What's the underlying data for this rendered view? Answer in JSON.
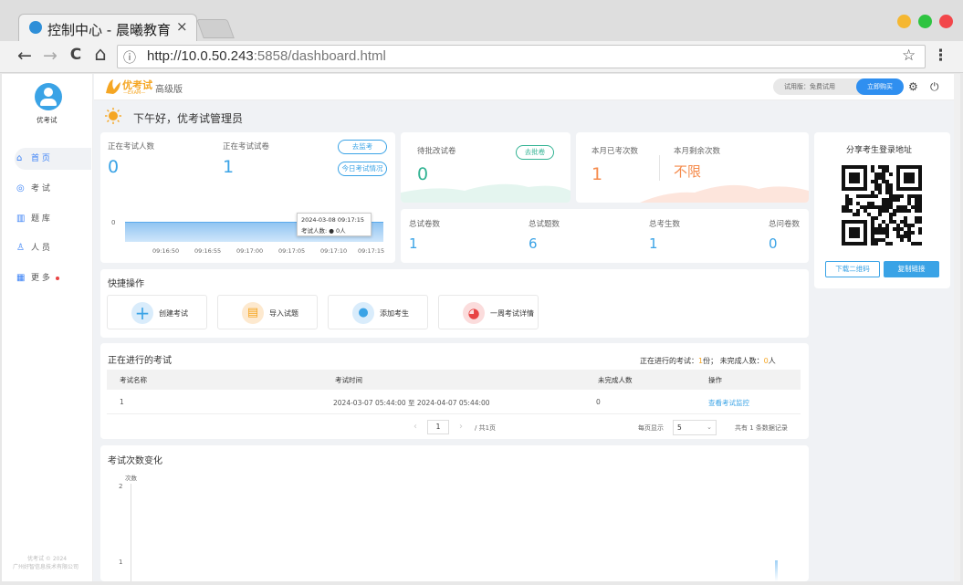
{
  "browser": {
    "tab_title": "控制中心 - 晨曦教育",
    "tab_close": "×",
    "url_host": "http://10.0.50.243",
    "url_path": ":5858/dashboard.html",
    "back": "←",
    "forward": "→",
    "reload": "C",
    "home": "⌂",
    "star": "☆",
    "menu": "⋮",
    "info": "ⓘ"
  },
  "sidebar": {
    "username": "优考试",
    "items": [
      {
        "label": "首 页",
        "icon": "home-icon",
        "glyph": "⌂"
      },
      {
        "label": "考 试",
        "icon": "exam-icon",
        "glyph": "◎"
      },
      {
        "label": "题 库",
        "icon": "question-bank-icon",
        "glyph": "▥"
      },
      {
        "label": "人 员",
        "icon": "person-icon",
        "glyph": "♙"
      },
      {
        "label": "更 多",
        "icon": "more-icon",
        "glyph": "▦"
      }
    ],
    "footer_line1": "优考试 © 2024",
    "footer_line2": "广州好智信息技术有限公司"
  },
  "header": {
    "logo_text": "优考试",
    "logo_sub": "—EXAM—",
    "edition": "高级版",
    "trial_label": "试用版：免费试用",
    "buy_label": "立即购买"
  },
  "greeting": "下午好，优考试管理员",
  "stats_online": {
    "examinee_label": "正在考试人数",
    "examinee_value": "0",
    "paper_label": "正在考试试卷",
    "paper_value": "1",
    "monitor_btn": "去监考",
    "today_btn": "今日考试情况",
    "chart_y_label": "0",
    "chart_x_ticks": [
      "09:16:50",
      "09:16:55",
      "09:17:00",
      "09:17:05",
      "09:17:10",
      "09:17:15"
    ],
    "tooltip_time": "2024-03-08 09:17:15",
    "tooltip_text": "考试人数: ● 0人"
  },
  "pending": {
    "label": "待批改试卷",
    "value": "0",
    "btn": "去批卷"
  },
  "month": {
    "done_label": "本月已考次数",
    "done_value": "1",
    "left_label": "本月剩余次数",
    "left_value": "不限"
  },
  "totals": [
    {
      "label": "总试卷数",
      "value": "1"
    },
    {
      "label": "总试题数",
      "value": "6"
    },
    {
      "label": "总考生数",
      "value": "1"
    },
    {
      "label": "总问卷数",
      "value": "0"
    }
  ],
  "share": {
    "title": "分享考生登录地址",
    "download_btn": "下载二维码",
    "copy_btn": "复制链接"
  },
  "quick": {
    "title": "快捷操作",
    "items": [
      {
        "label": "创建考试",
        "icon": "plus-icon",
        "glyph": "+",
        "color": "#3aa3e6"
      },
      {
        "label": "导入试题",
        "icon": "document-icon",
        "glyph": "▤",
        "color": "#f5a623"
      },
      {
        "label": "添加考生",
        "icon": "user-icon",
        "glyph": "●",
        "color": "#3aa3e6"
      },
      {
        "label": "一周考试详情",
        "icon": "pie-chart-icon",
        "glyph": "◕",
        "color": "#e84343"
      }
    ]
  },
  "ongoing": {
    "title": "正在进行的考试",
    "summary_prefix": "正在进行的考试：",
    "summary_count": "1",
    "summary_mid": "份；  未完成人数：",
    "summary_unfinished": "0",
    "summary_suffix": "人",
    "columns": [
      "考试名称",
      "考试时间",
      "未完成人数",
      "操作"
    ],
    "rows": [
      {
        "name": "1",
        "time": "2024-03-07 05:44:00 至 2024-04-07 05:44:00",
        "unfinished": "0",
        "action": "查看考试监控"
      }
    ],
    "pagination": {
      "prev": "‹",
      "page": "1",
      "next": "›",
      "total_pages": "/ 共1页",
      "per_page_label": "每页显示",
      "per_page": "5",
      "records": "共有 1 条数据记录"
    }
  },
  "trend": {
    "title": "考试次数变化",
    "y_label": "次数",
    "y_ticks": [
      "2",
      "1"
    ]
  },
  "colors": {
    "accent": "#3aa3e6",
    "green": "#32b393",
    "orange": "#f5a623",
    "red": "#e84343"
  }
}
